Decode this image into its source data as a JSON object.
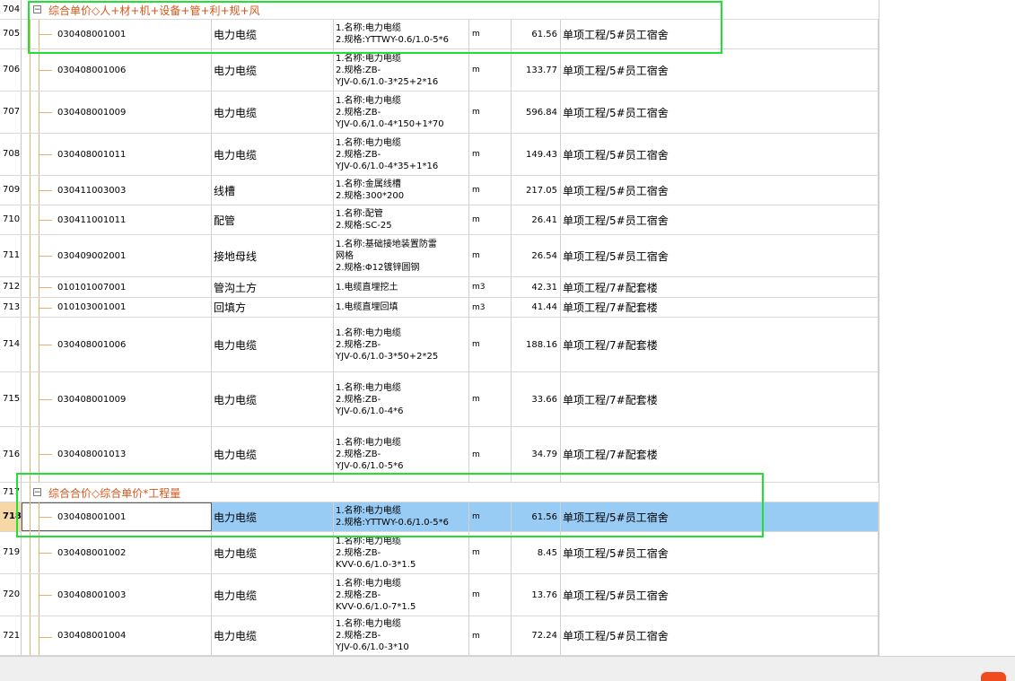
{
  "group_rows": [
    {
      "num": "704",
      "label": "综合单价◇人+材+机+设备+管+利+规+风"
    },
    {
      "num": "717",
      "label": "综合合价◇综合单价*工程量"
    }
  ],
  "rows": [
    {
      "num": "705",
      "code": "030408001001",
      "name": "电力电缆",
      "features": "1.名称:电力电缆\n2.规格:YTTWY-0.6/1.0-5*6",
      "unit": "m",
      "qty": "61.56",
      "location": "单项工程/5#员工宿舍"
    },
    {
      "num": "706",
      "code": "030408001006",
      "name": "电力电缆",
      "features": "1.名称:电力电缆\n2.规格:ZB-\nYJV-0.6/1.0-3*25+2*16",
      "unit": "m",
      "qty": "133.77",
      "location": "单项工程/5#员工宿舍"
    },
    {
      "num": "707",
      "code": "030408001009",
      "name": "电力电缆",
      "features": "1.名称:电力电缆\n2.规格:ZB-\nYJV-0.6/1.0-4*150+1*70",
      "unit": "m",
      "qty": "596.84",
      "location": "单项工程/5#员工宿舍"
    },
    {
      "num": "708",
      "code": "030408001011",
      "name": "电力电缆",
      "features": "1.名称:电力电缆\n2.规格:ZB-\nYJV-0.6/1.0-4*35+1*16",
      "unit": "m",
      "qty": "149.43",
      "location": "单项工程/5#员工宿舍"
    },
    {
      "num": "709",
      "code": "030411003003",
      "name": "线槽",
      "features": "1.名称:金属线槽\n2.规格:300*200",
      "unit": "m",
      "qty": "217.05",
      "location": "单项工程/5#员工宿舍"
    },
    {
      "num": "710",
      "code": "030411001011",
      "name": "配管",
      "features": "1.名称:配管\n2.规格:SC-25",
      "unit": "m",
      "qty": "26.41",
      "location": "单项工程/5#员工宿舍"
    },
    {
      "num": "711",
      "code": "030409002001",
      "name": "接地母线",
      "features": "1.名称:基础接地装置防雷\n网格\n2.规格:Φ12镀锌圆钢",
      "unit": "m",
      "qty": "26.54",
      "location": "单项工程/5#员工宿舍"
    },
    {
      "num": "712",
      "code": "010101007001",
      "name": "管沟土方",
      "features": "1.电缆直埋挖土",
      "unit": "m3",
      "qty": "42.31",
      "location": "单项工程/7#配套楼"
    },
    {
      "num": "713",
      "code": "010103001001",
      "name": "回填方",
      "features": "1.电缆直埋回填",
      "unit": "m3",
      "qty": "41.44",
      "location": "单项工程/7#配套楼"
    },
    {
      "num": "714",
      "code": "030408001006",
      "name": "电力电缆",
      "features": "1.名称:电力电缆\n2.规格:ZB-\nYJV-0.6/1.0-3*50+2*25",
      "unit": "m",
      "qty": "188.16",
      "location": "单项工程/7#配套楼"
    },
    {
      "num": "715",
      "code": "030408001009",
      "name": "电力电缆",
      "features": "1.名称:电力电缆\n2.规格:ZB-\nYJV-0.6/1.0-4*6",
      "unit": "m",
      "qty": "33.66",
      "location": "单项工程/7#配套楼"
    },
    {
      "num": "716",
      "code": "030408001013",
      "name": "电力电缆",
      "features": "1.名称:电力电缆\n2.规格:ZB-\nYJV-0.6/1.0-5*6",
      "unit": "m",
      "qty": "34.79",
      "location": "单项工程/7#配套楼"
    },
    {
      "num": "718",
      "code": "030408001001",
      "name": "电力电缆",
      "features": "1.名称:电力电缆\n2.规格:YTTWY-0.6/1.0-5*6",
      "unit": "m",
      "qty": "61.56",
      "location": "单项工程/5#员工宿舍"
    },
    {
      "num": "719",
      "code": "030408001002",
      "name": "电力电缆",
      "features": "1.名称:电力电缆\n2.规格:ZB-\nKVV-0.6/1.0-3*1.5",
      "unit": "m",
      "qty": "8.45",
      "location": "单项工程/5#员工宿舍"
    },
    {
      "num": "720",
      "code": "030408001003",
      "name": "电力电缆",
      "features": "1.名称:电力电缆\n2.规格:ZB-\nKVV-0.6/1.0-7*1.5",
      "unit": "m",
      "qty": "13.76",
      "location": "单项工程/5#员工宿舍"
    },
    {
      "num": "721",
      "code": "030408001004",
      "name": "电力电缆",
      "features": "1.名称:电力电缆\n2.规格:ZB-\nYJV-0.6/1.0-3*10",
      "unit": "m",
      "qty": "72.24",
      "location": "单项工程/5#员工宿舍"
    }
  ],
  "colors": {
    "selected_row": "#99ccf5",
    "highlight_box": "#22e033",
    "group_label": "#d8561a"
  }
}
